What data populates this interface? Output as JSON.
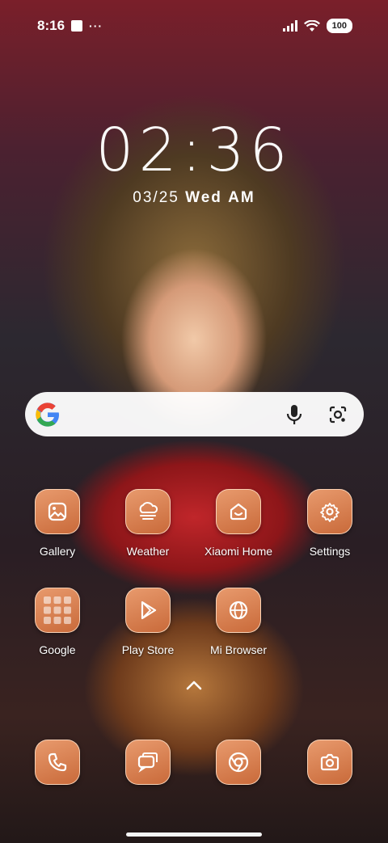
{
  "status_bar": {
    "time": "8:16",
    "dots": "···",
    "battery": "100"
  },
  "lockscreen": {
    "time": "02:36",
    "date_prefix": "03/25",
    "weekday": "Wed",
    "ampm": "AM"
  },
  "search_bar": {
    "logo": "google-g-icon",
    "voice_icon": "microphone-icon",
    "lens_icon": "camera-lens-icon"
  },
  "apps": [
    {
      "label": "Gallery",
      "icon": "gallery-icon"
    },
    {
      "label": "Weather",
      "icon": "weather-icon"
    },
    {
      "label": "Xiaomi Home",
      "icon": "home-icon"
    },
    {
      "label": "Settings",
      "icon": "gear-icon"
    },
    {
      "label": "Google",
      "icon": "app-folder-icon"
    },
    {
      "label": "Play Store",
      "icon": "play-store-icon"
    },
    {
      "label": "Mi Browser",
      "icon": "globe-icon"
    }
  ],
  "dock": [
    {
      "icon": "phone-icon"
    },
    {
      "icon": "messages-icon"
    },
    {
      "icon": "chrome-icon"
    },
    {
      "icon": "camera-icon"
    }
  ],
  "colors": {
    "tile_top": "#e89a6d",
    "tile_bottom": "#c96a3a",
    "search_bg": "#ffffff"
  }
}
